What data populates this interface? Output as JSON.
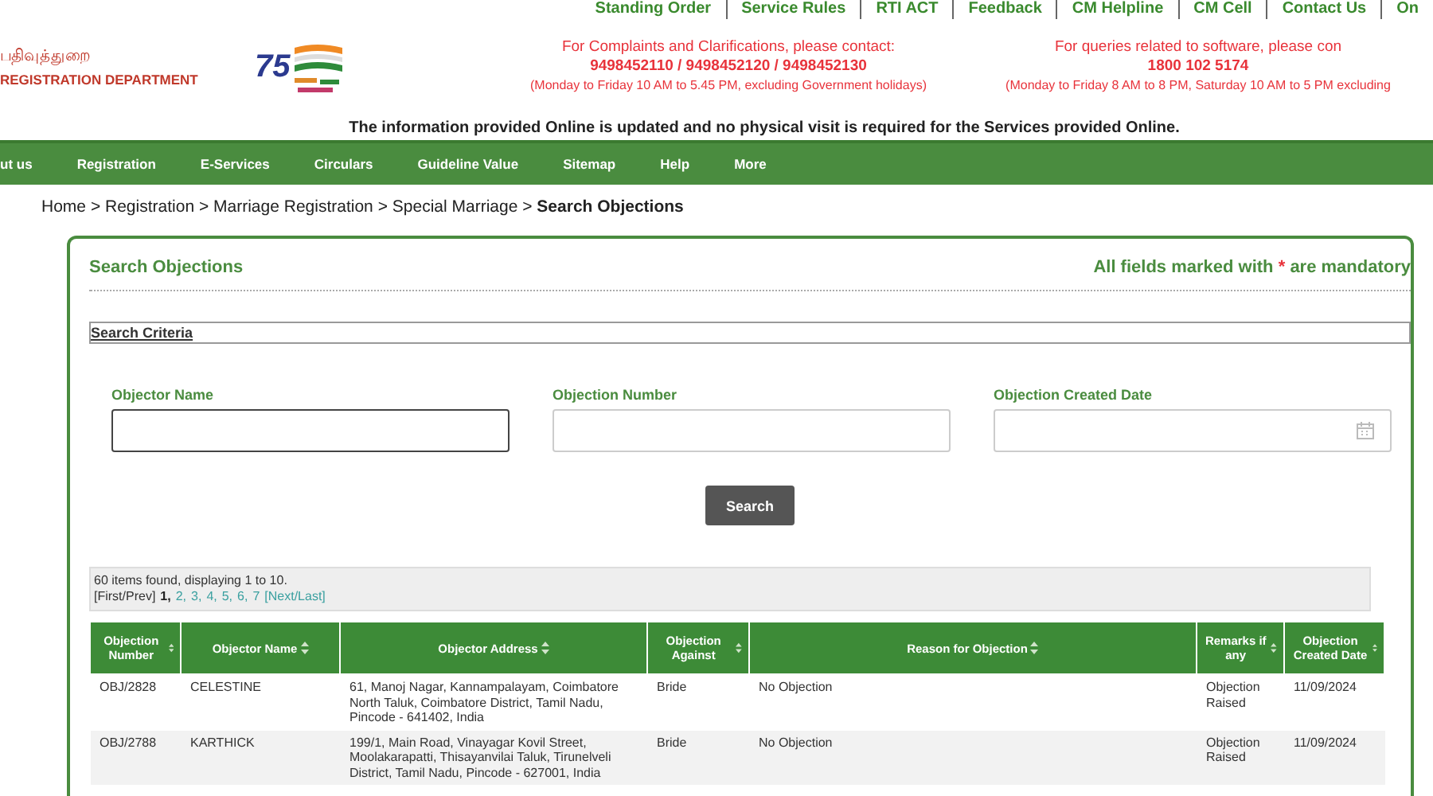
{
  "top_links": [
    "Standing Order",
    "Service Rules",
    "RTI ACT",
    "Feedback",
    "CM Helpline",
    "CM Cell",
    "Contact Us",
    "On"
  ],
  "brand": {
    "tamil": "பதிவுத்துறை",
    "name": "REGISTRATION DEPARTMENT",
    "logo_text": "75"
  },
  "contacts": [
    {
      "title": "For Complaints and Clarifications, please contact:",
      "phone": "9498452110 / 9498452120 / 9498452130",
      "hours": "(Monday to Friday 10 AM to 5.45 PM, excluding Government holidays)"
    },
    {
      "title": "For queries related to software, please con",
      "phone": "1800 102 5174",
      "hours": "(Monday to Friday 8 AM to 8 PM, Saturday 10 AM to 5 PM excluding"
    }
  ],
  "notice": "The information provided Online is updated and no physical visit is required for the Services provided Online.",
  "nav": [
    "ut us",
    "Registration",
    "E-Services",
    "Circulars",
    "Guideline Value",
    "Sitemap",
    "Help",
    "More"
  ],
  "breadcrumb": {
    "items": [
      "Home",
      "Registration",
      "Marriage Registration",
      "Special Marriage"
    ],
    "separator": ">",
    "current": "Search Objections"
  },
  "panel": {
    "title": "Search Objections",
    "mandatory_note": {
      "before": "All fields marked with",
      "mark": "*",
      "after": "are mandatory"
    },
    "section": "Search Criteria",
    "fields": [
      {
        "label": "Objector Name",
        "kind": "text",
        "focused": true
      },
      {
        "label": "Objection Number",
        "kind": "text",
        "focused": false
      },
      {
        "label": "Objection Created Date",
        "kind": "date",
        "focused": false
      }
    ],
    "search_button": "Search",
    "pager": {
      "summary": "60 items found, displaying 1 to 10.",
      "first_prev": "[First/Prev]",
      "pages": [
        {
          "label": "1,",
          "selected": true
        },
        {
          "label": "2,",
          "selected": false
        },
        {
          "label": "3,",
          "selected": false
        },
        {
          "label": "4,",
          "selected": false
        },
        {
          "label": "5,",
          "selected": false
        },
        {
          "label": "6,",
          "selected": false
        },
        {
          "label": "7",
          "selected": false
        }
      ],
      "next_last": "[Next/Last]"
    },
    "table": {
      "columns": [
        "Objection Number",
        "Objector Name",
        "Objector Address",
        "Objection Against",
        "Reason for Objection",
        "Remarks if any",
        "Objection Created Date"
      ],
      "rows": [
        [
          "OBJ/2828",
          "CELESTINE",
          "61, Manoj Nagar, Kannampalayam, Coimbatore North Taluk, Coimbatore District, Tamil Nadu, Pincode - 641402, India",
          "Bride",
          "No Objection",
          "Objection Raised",
          "11/09/2024"
        ],
        [
          "OBJ/2788",
          "KARTHICK",
          "199/1, Main Road, Vinayagar Kovil Street, Moolakarapatti, Thisayanvilai Taluk, Tirunelveli District, Tamil Nadu, Pincode - 627001, India",
          "Bride",
          "No Objection",
          "Objection Raised",
          "11/09/2024"
        ]
      ]
    }
  }
}
